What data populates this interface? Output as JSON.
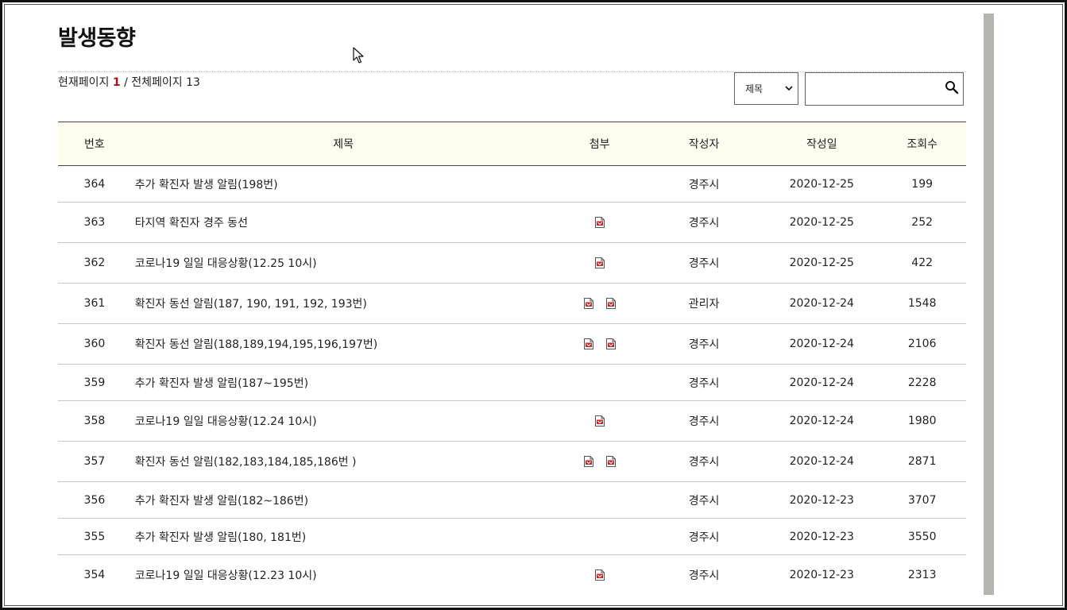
{
  "page": {
    "title": "발생동향"
  },
  "pagination": {
    "current_label": "현재페이지",
    "current_page": "1",
    "total_label": "/ 전체페이지",
    "total_pages": "13"
  },
  "search": {
    "field_selected": "제목",
    "value": ""
  },
  "table": {
    "headers": {
      "no": "번호",
      "title": "제목",
      "attach": "첨부",
      "author": "작성자",
      "date": "작성일",
      "views": "조회수"
    },
    "rows": [
      {
        "no": "364",
        "title": "추가 확진자 발생 알림(198번)",
        "attachments": 0,
        "author": "경주시",
        "date": "2020-12-25",
        "views": "199"
      },
      {
        "no": "363",
        "title": "타지역 확진자 경주 동선",
        "attachments": 1,
        "author": "경주시",
        "date": "2020-12-25",
        "views": "252"
      },
      {
        "no": "362",
        "title": "코로나19 일일 대응상황(12.25 10시)",
        "attachments": 1,
        "author": "경주시",
        "date": "2020-12-25",
        "views": "422"
      },
      {
        "no": "361",
        "title": "확진자 동선 알림(187, 190, 191, 192, 193번)",
        "attachments": 2,
        "author": "관리자",
        "date": "2020-12-24",
        "views": "1548"
      },
      {
        "no": "360",
        "title": "확진자 동선 알림(188,189,194,195,196,197번)",
        "attachments": 2,
        "author": "경주시",
        "date": "2020-12-24",
        "views": "2106"
      },
      {
        "no": "359",
        "title": "추가 확진자 발생 알림(187~195번)",
        "attachments": 0,
        "author": "경주시",
        "date": "2020-12-24",
        "views": "2228"
      },
      {
        "no": "358",
        "title": "코로나19 일일 대응상황(12.24 10시)",
        "attachments": 1,
        "author": "경주시",
        "date": "2020-12-24",
        "views": "1980"
      },
      {
        "no": "357",
        "title": "확진자 동선 알림(182,183,184,185,186번 )",
        "attachments": 2,
        "author": "경주시",
        "date": "2020-12-24",
        "views": "2871"
      },
      {
        "no": "356",
        "title": "추가 확진자 발생 알림(182~186번)",
        "attachments": 0,
        "author": "경주시",
        "date": "2020-12-23",
        "views": "3707"
      },
      {
        "no": "355",
        "title": "추가 확진자 발생 알림(180, 181번)",
        "attachments": 0,
        "author": "경주시",
        "date": "2020-12-23",
        "views": "3550"
      },
      {
        "no": "354",
        "title": "코로나19 일일 대응상황(12.23 10시)",
        "attachments": 1,
        "author": "경주시",
        "date": "2020-12-23",
        "views": "2313"
      }
    ]
  },
  "icons": {
    "attachment": "pdf-file-icon",
    "search": "search-icon",
    "dropdown": "chevron-down-icon",
    "cursor": "mouse-cursor-icon"
  },
  "colors": {
    "header_bg": "#fdfcee",
    "current_page": "#b01010",
    "attachment_icon": "#c62828"
  }
}
